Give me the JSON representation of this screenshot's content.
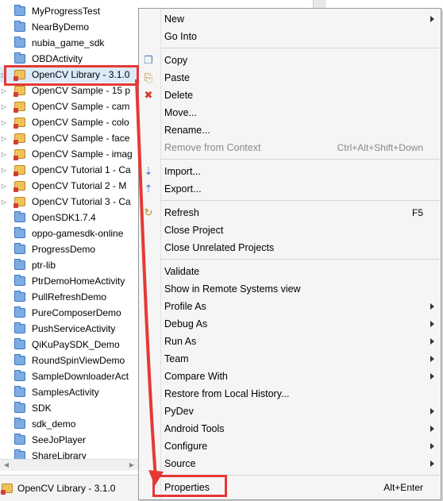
{
  "explorer": {
    "items": [
      {
        "label": "MyProgressTest",
        "kind": "folder",
        "twisty": false
      },
      {
        "label": "NearByDemo",
        "kind": "folder",
        "twisty": false
      },
      {
        "label": "nubia_game_sdk",
        "kind": "folder",
        "twisty": false
      },
      {
        "label": "OBDActivity",
        "kind": "folder",
        "twisty": false
      },
      {
        "label": "OpenCV Library - 3.1.0",
        "kind": "project",
        "twisty": true,
        "selected": true
      },
      {
        "label": "OpenCV Sample - 15 p",
        "kind": "project",
        "twisty": true
      },
      {
        "label": "OpenCV Sample - cam",
        "kind": "project",
        "twisty": true
      },
      {
        "label": "OpenCV Sample - colo",
        "kind": "project",
        "twisty": true
      },
      {
        "label": "OpenCV Sample - face",
        "kind": "project",
        "twisty": true
      },
      {
        "label": "OpenCV Sample - imag",
        "kind": "project",
        "twisty": true
      },
      {
        "label": "OpenCV Tutorial 1 - Ca",
        "kind": "project",
        "twisty": true
      },
      {
        "label": "OpenCV Tutorial 2 - M",
        "kind": "project",
        "twisty": true
      },
      {
        "label": "OpenCV Tutorial 3 - Ca",
        "kind": "project",
        "twisty": true
      },
      {
        "label": "OpenSDK1.7.4",
        "kind": "folder",
        "twisty": false
      },
      {
        "label": "oppo-gamesdk-online",
        "kind": "folder",
        "twisty": false
      },
      {
        "label": "ProgressDemo",
        "kind": "folder",
        "twisty": false
      },
      {
        "label": "ptr-lib",
        "kind": "folder",
        "twisty": false
      },
      {
        "label": "PtrDemoHomeActivity",
        "kind": "folder",
        "twisty": false
      },
      {
        "label": "PullRefreshDemo",
        "kind": "folder",
        "twisty": false
      },
      {
        "label": "PureComposerDemo",
        "kind": "folder",
        "twisty": false
      },
      {
        "label": "PushServiceActivity",
        "kind": "folder",
        "twisty": false
      },
      {
        "label": "QiKuPaySDK_Demo",
        "kind": "folder",
        "twisty": false
      },
      {
        "label": "RoundSpinViewDemo",
        "kind": "folder",
        "twisty": false
      },
      {
        "label": "SampleDownloaderAct",
        "kind": "folder",
        "twisty": false
      },
      {
        "label": "SamplesActivity",
        "kind": "folder",
        "twisty": false
      },
      {
        "label": "SDK",
        "kind": "folder",
        "twisty": false
      },
      {
        "label": "sdk_demo",
        "kind": "folder",
        "twisty": false
      },
      {
        "label": "SeeJoPlayer",
        "kind": "folder",
        "twisty": false
      },
      {
        "label": "ShareLibrary",
        "kind": "folder",
        "twisty": false
      }
    ]
  },
  "status": {
    "label": "OpenCV Library - 3.1.0"
  },
  "menu": {
    "items": [
      {
        "label": "New",
        "submenu": true
      },
      {
        "label": "Go Into"
      },
      {
        "sep": true
      },
      {
        "label": "Copy",
        "icon": "copy-icon"
      },
      {
        "label": "Paste",
        "icon": "paste-icon"
      },
      {
        "label": "Delete",
        "icon": "delete-icon"
      },
      {
        "label": "Move..."
      },
      {
        "label": "Rename..."
      },
      {
        "label": "Remove from Context",
        "shortcut": "Ctrl+Alt+Shift+Down",
        "disabled": true
      },
      {
        "sep": true
      },
      {
        "label": "Import...",
        "icon": "import-icon"
      },
      {
        "label": "Export...",
        "icon": "export-icon"
      },
      {
        "sep": true
      },
      {
        "label": "Refresh",
        "icon": "refresh-icon",
        "shortcut": "F5"
      },
      {
        "label": "Close Project"
      },
      {
        "label": "Close Unrelated Projects"
      },
      {
        "sep": true
      },
      {
        "label": "Validate"
      },
      {
        "label": "Show in Remote Systems view"
      },
      {
        "label": "Profile As",
        "submenu": true
      },
      {
        "label": "Debug As",
        "submenu": true
      },
      {
        "label": "Run As",
        "submenu": true
      },
      {
        "label": "Team",
        "submenu": true
      },
      {
        "label": "Compare With",
        "submenu": true
      },
      {
        "label": "Restore from Local History..."
      },
      {
        "label": "PyDev",
        "submenu": true
      },
      {
        "label": "Android Tools",
        "submenu": true
      },
      {
        "label": "Configure",
        "submenu": true
      },
      {
        "label": "Source",
        "submenu": true
      },
      {
        "sep": true
      },
      {
        "label": "Properties",
        "shortcut": "Alt+Enter",
        "highlight": true
      }
    ]
  },
  "colors": {
    "annotation": "#e53935",
    "folder": "#7dace3",
    "menu_bg": "#f5f5f5"
  }
}
